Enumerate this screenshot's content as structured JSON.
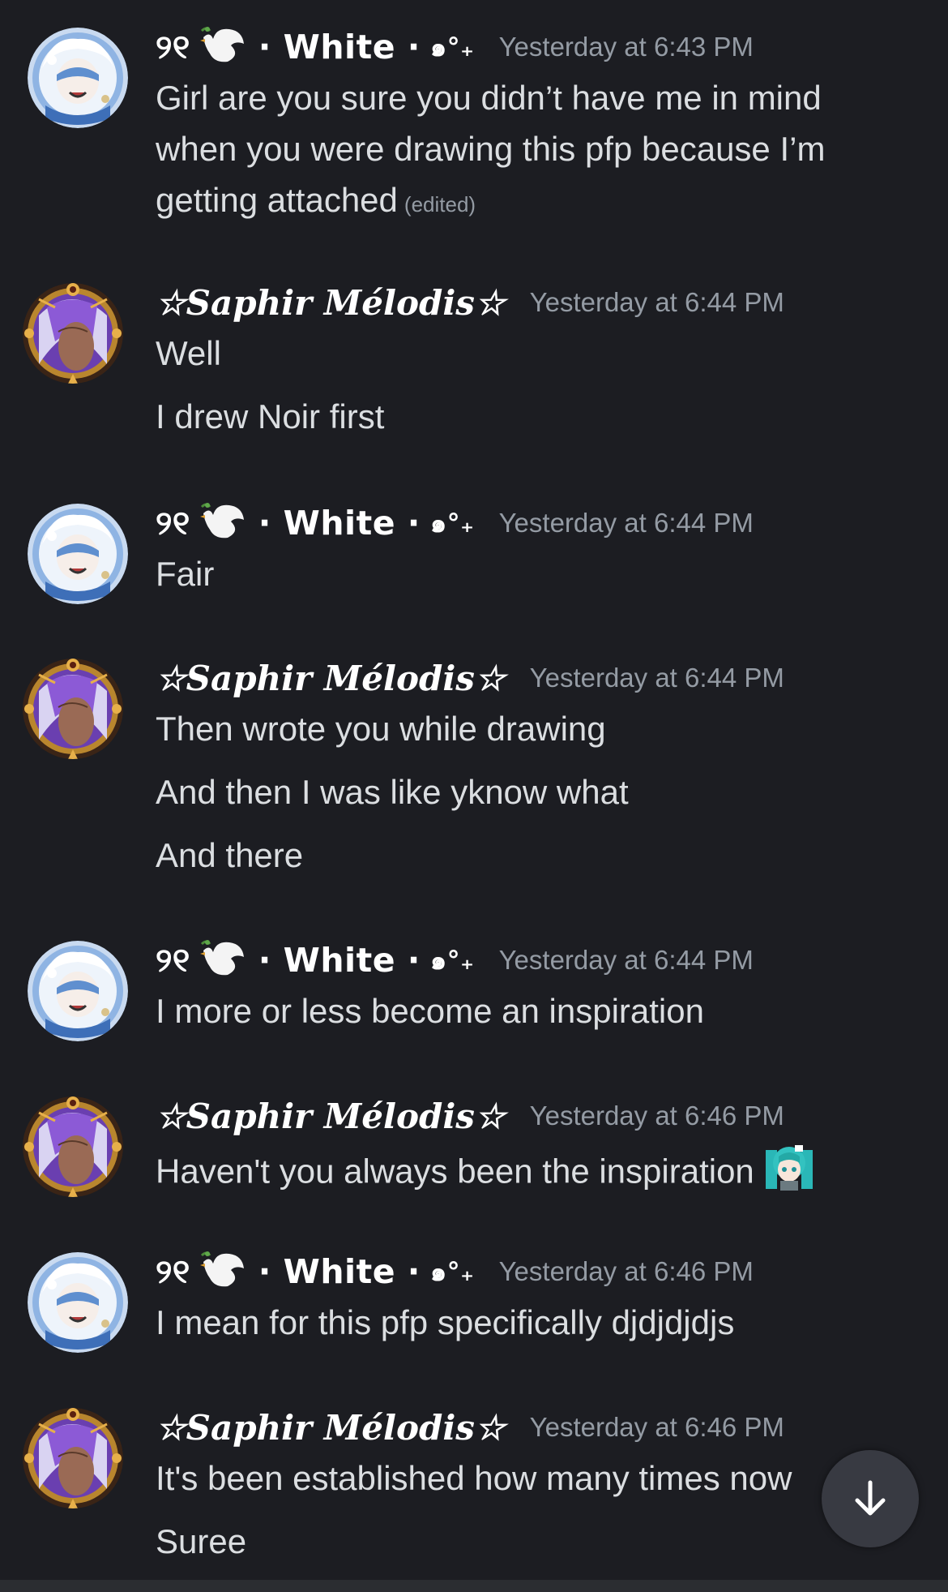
{
  "users": {
    "white": {
      "name_prefix": "୨୧",
      "name": "· White ·",
      "name_suffix": "๑°₊",
      "icon": "dove-emoji"
    },
    "saphir": {
      "name": "☆𝑺𝒂𝒑𝒉𝒊𝒓 𝑴𝒆́𝒍𝒐𝒅𝒊𝒔☆"
    }
  },
  "messages": [
    {
      "author": "white",
      "timestamp": "Yesterday at 6:43 PM",
      "lines": [
        "Girl are you sure you didn’t have me in mind",
        "when you were drawing this pfp because I’m",
        "getting attached"
      ],
      "edited": "(edited)"
    },
    {
      "author": "saphir",
      "timestamp": "Yesterday at 6:44 PM",
      "lines": [
        "Well",
        "I drew Noir first"
      ]
    },
    {
      "author": "white",
      "timestamp": "Yesterday at 6:44 PM",
      "lines": [
        "Fair"
      ]
    },
    {
      "author": "saphir",
      "timestamp": "Yesterday at 6:44 PM",
      "lines": [
        "Then wrote you while drawing",
        "And then I was like yknow what",
        "And there"
      ]
    },
    {
      "author": "white",
      "timestamp": "Yesterday at 6:44 PM",
      "lines": [
        "I more or less become an inspiration"
      ]
    },
    {
      "author": "saphir",
      "timestamp": "Yesterday at 6:46 PM",
      "lines": [
        "Haven't you always been the inspiration"
      ],
      "emoji": "miku-emoji"
    },
    {
      "author": "white",
      "timestamp": "Yesterday at 6:46 PM",
      "lines": [
        "I mean for this pfp specifically djdjdjdjs"
      ]
    },
    {
      "author": "saphir",
      "timestamp": "Yesterday at 6:46 PM",
      "lines": [
        "It's been established how many times now",
        "Suree"
      ]
    }
  ],
  "scroll_button": {
    "icon": "arrow-down-icon"
  },
  "colors": {
    "background": "#1c1d22",
    "text": "#dbdee1",
    "timestamp": "#949ba4",
    "username": "#ffffff"
  }
}
